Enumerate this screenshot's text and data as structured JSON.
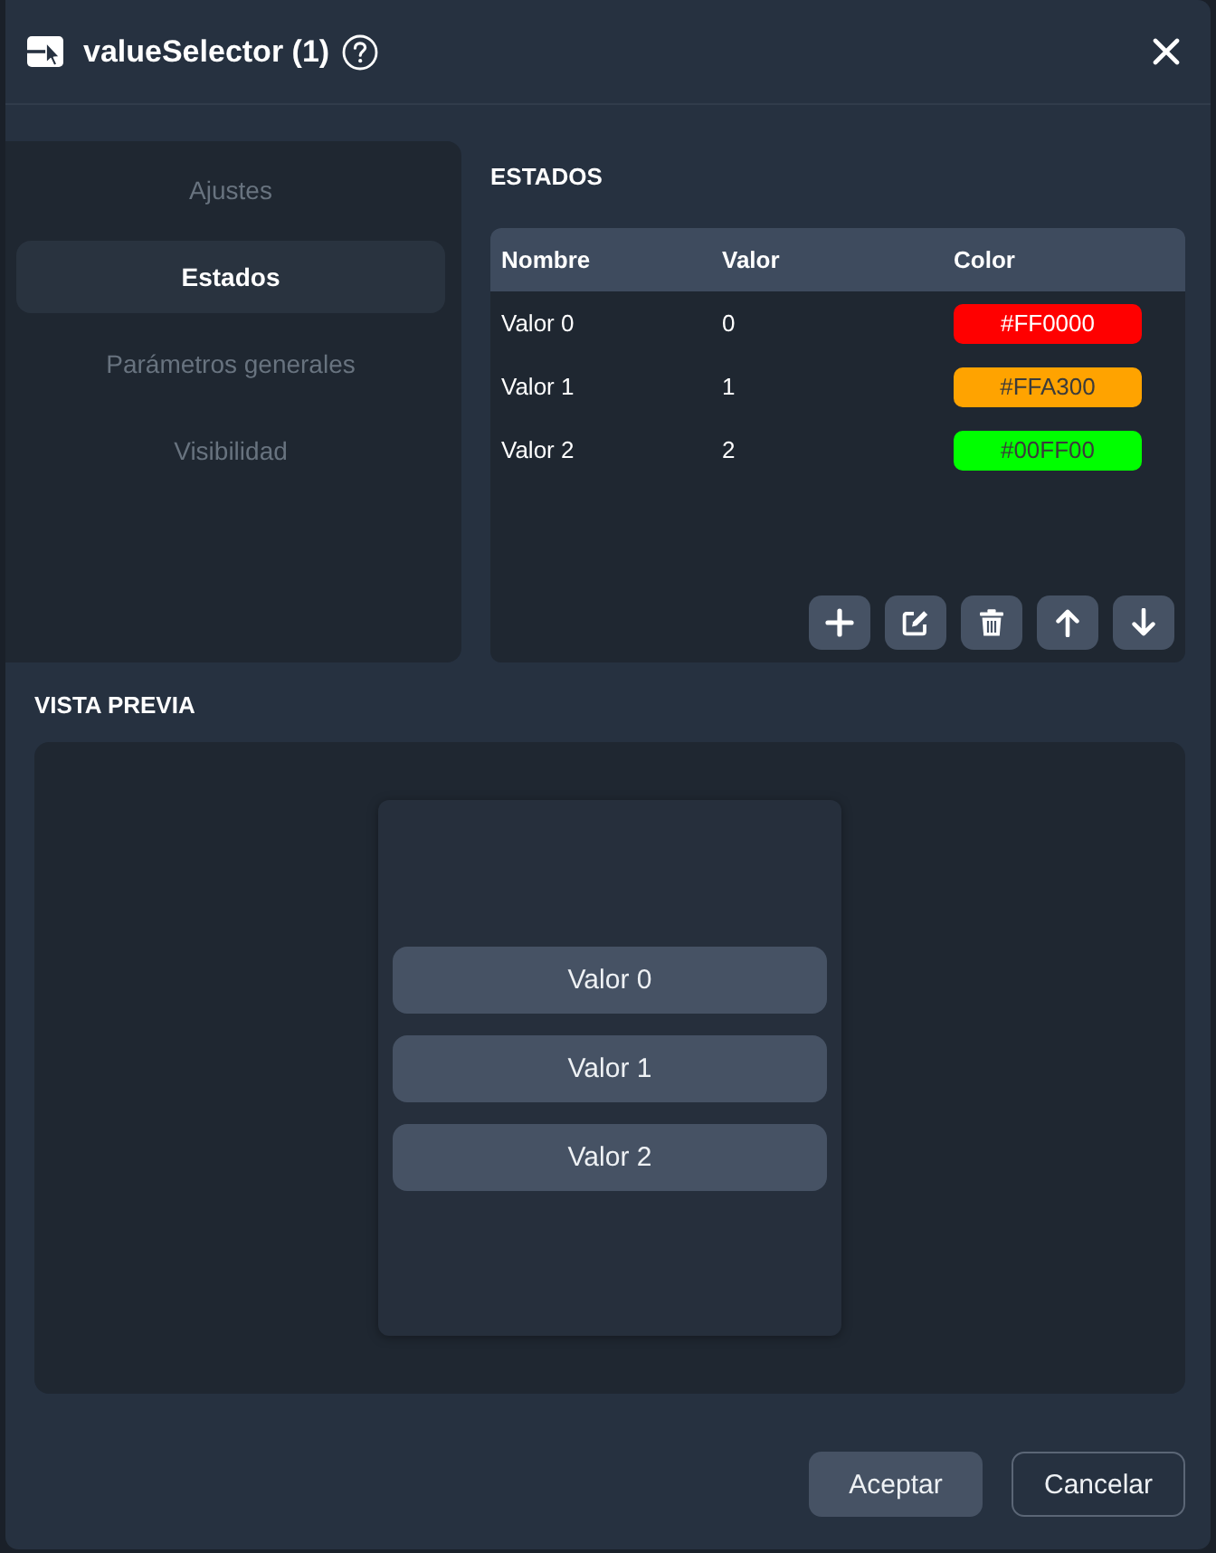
{
  "window": {
    "title": "valueSelector (1)"
  },
  "sidebar": {
    "items": [
      {
        "label": "Ajustes",
        "selected": false
      },
      {
        "label": "Estados",
        "selected": true
      },
      {
        "label": "Parámetros generales",
        "selected": false
      },
      {
        "label": "Visibilidad",
        "selected": false
      }
    ]
  },
  "states": {
    "title": "ESTADOS",
    "table": {
      "columns": [
        "Nombre",
        "Valor",
        "Color"
      ],
      "rows": [
        {
          "name": "Valor 0",
          "value": "0",
          "color_label": "#FF0000",
          "color": "#ff0000"
        },
        {
          "name": "Valor 1",
          "value": "1",
          "color_label": "#FFA300",
          "color": "#ffa300"
        },
        {
          "name": "Valor 2",
          "value": "2",
          "color_label": "#00FF00",
          "color": "#00ff00"
        }
      ]
    }
  },
  "preview": {
    "title": "VISTA PREVIA",
    "buttons": [
      "Valor 0",
      "Valor 1",
      "Valor 2"
    ]
  },
  "footer": {
    "buttons": [
      {
        "label": "Aceptar",
        "kind": "primary"
      },
      {
        "label": "Cancelar",
        "kind": "secondary"
      }
    ]
  }
}
